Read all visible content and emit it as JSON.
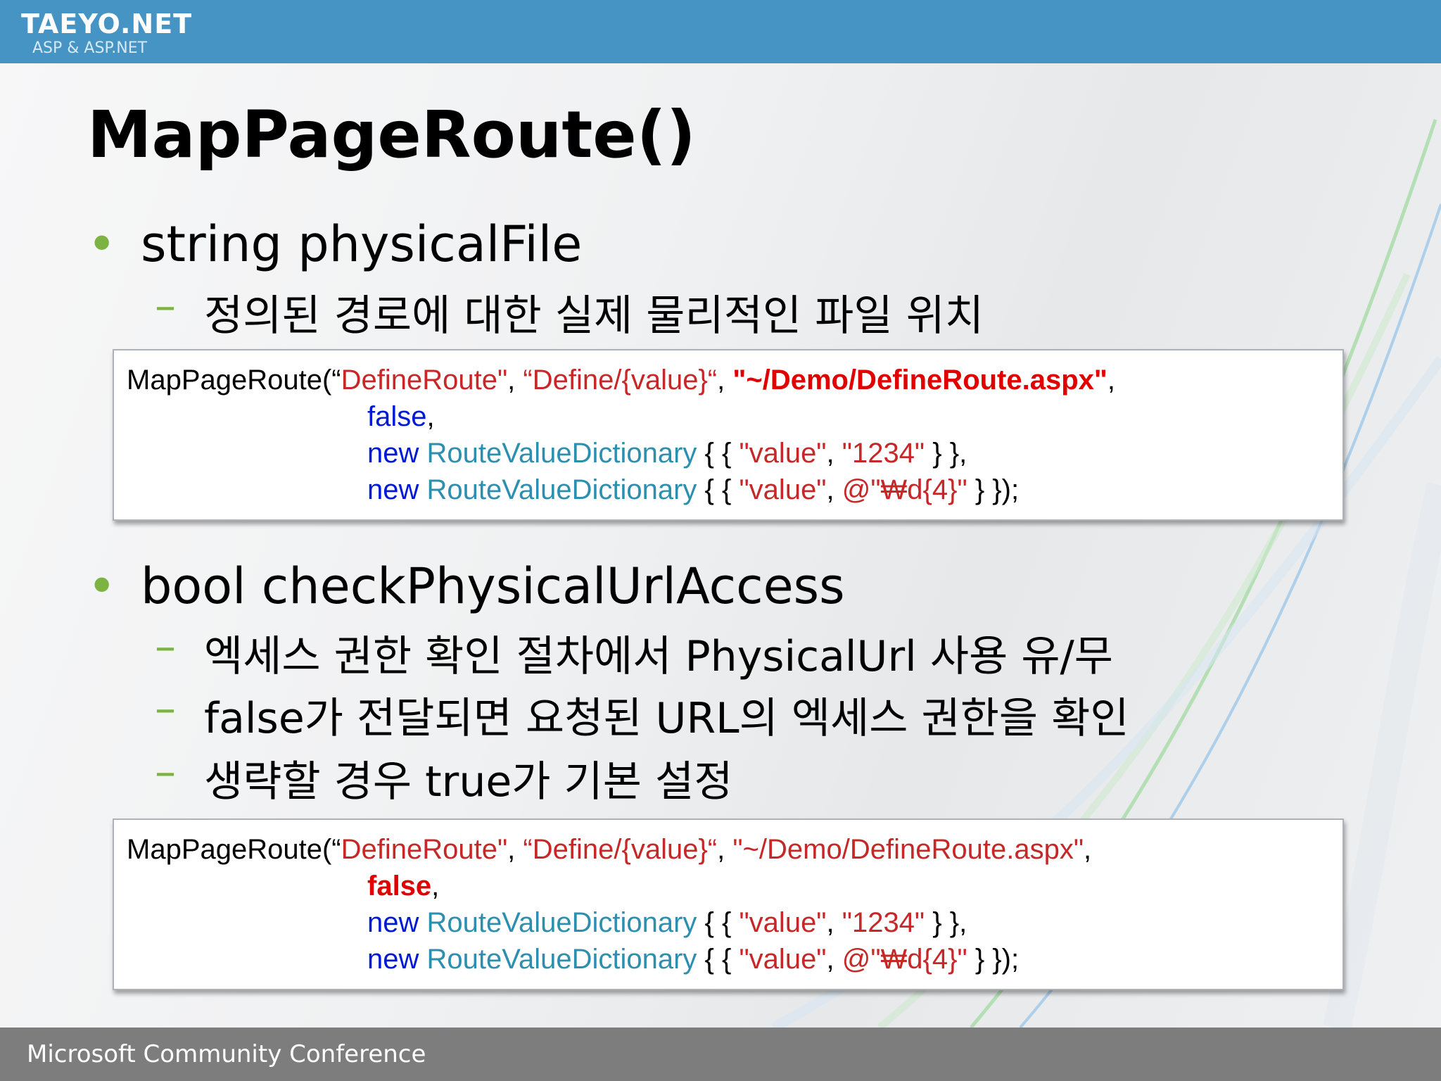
{
  "header": {
    "logo": "TAEYO.NET",
    "logo_sub": "ASP & ASP.NET"
  },
  "title": "MapPageRoute()",
  "section1": {
    "bullet": "string physicalFile",
    "subs": [
      "정의된 경로에 대한 실제 물리적인 파일 위치"
    ]
  },
  "code1": {
    "l1_fn": "MapPageRoute(“",
    "l1_name": "DefineRoute\"",
    "l1_sep1": ", ",
    "l1_url": "“Define/{value}“",
    "l1_sep2": ", ",
    "l1_file": "\"~/Demo/DefineRoute.aspx\"",
    "l1_end": ",",
    "l2_false": "false",
    "l2_end": ",",
    "l3_new": "new",
    "l3_type": "RouteValueDictionary",
    "l3_open": " { { ",
    "l3_key": "\"value\"",
    "l3_sep": ", ",
    "l3_val": "\"1234\"",
    "l3_close": " } },",
    "l4_new": "new",
    "l4_type": "RouteValueDictionary",
    "l4_open": " { { ",
    "l4_key": "\"value\"",
    "l4_sep": ", ",
    "l4_val": "@\"₩d{4}\"",
    "l4_close": " } });"
  },
  "section2": {
    "bullet": "bool checkPhysicalUrlAccess",
    "subs": [
      "엑세스 권한 확인 절차에서 PhysicalUrl 사용 유/무",
      "false가 전달되면 요청된 URL의 엑세스 권한을 확인",
      "생략할 경우 true가 기본 설정"
    ]
  },
  "code2": {
    "l1_fn": "MapPageRoute(“",
    "l1_name": "DefineRoute\"",
    "l1_sep1": ", ",
    "l1_url": "“Define/{value}“",
    "l1_sep2": ", ",
    "l1_file": "\"~/Demo/DefineRoute.aspx\"",
    "l1_end": ",",
    "l2_false": "false",
    "l2_end": ",",
    "l3_new": "new",
    "l3_type": "RouteValueDictionary",
    "l3_open": " { { ",
    "l3_key": "\"value\"",
    "l3_sep": ", ",
    "l3_val": "\"1234\"",
    "l3_close": " } },",
    "l4_new": "new",
    "l4_type": "RouteValueDictionary",
    "l4_open": " { { ",
    "l4_key": "\"value\"",
    "l4_sep": ", ",
    "l4_val": "@\"₩d{4}\"",
    "l4_close": " } });"
  },
  "footer": {
    "text": "Microsoft Community Conference"
  }
}
